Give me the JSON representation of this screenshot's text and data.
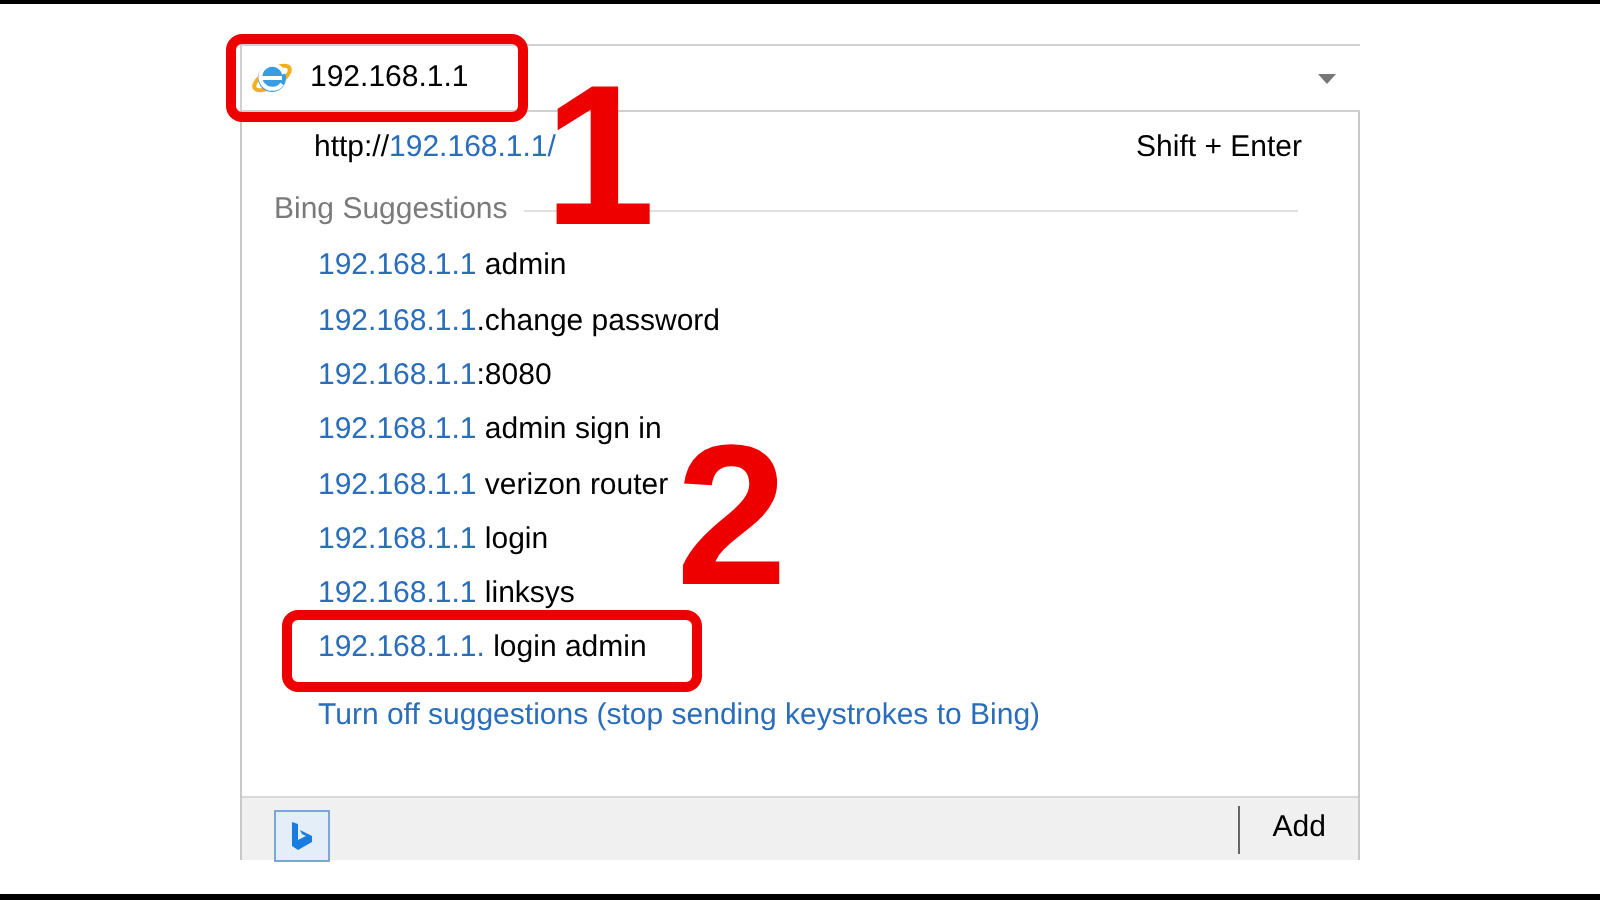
{
  "address_bar": {
    "value": "192.168.1.1"
  },
  "dropdown": {
    "go_entry": {
      "scheme": "http://",
      "address": "192.168.1.1/",
      "shortcut": "Shift + Enter"
    },
    "section_title": "Bing Suggestions",
    "suggestions": [
      {
        "match": "192.168.1.1",
        "rest": " admin"
      },
      {
        "match": "192.168.1.1",
        "rest": ".change password"
      },
      {
        "match": "192.168.1.1",
        "rest": ":8080"
      },
      {
        "match": "192.168.1.1",
        "rest": " admin sign in"
      },
      {
        "match": "192.168.1.1",
        "rest": " verizon router"
      },
      {
        "match": "192.168.1.1",
        "rest": " login"
      },
      {
        "match": "192.168.1.1",
        "rest": " linksys"
      },
      {
        "match": "192.168.1.1.",
        "rest": " login admin"
      }
    ],
    "turn_off_link": "Turn off suggestions (stop sending keystrokes to Bing)",
    "footer": {
      "add_button": "Add"
    }
  },
  "annotations": [
    {
      "kind": "box"
    },
    {
      "kind": "number",
      "label": "1"
    },
    {
      "kind": "number",
      "label": "2"
    },
    {
      "kind": "box"
    }
  ]
}
